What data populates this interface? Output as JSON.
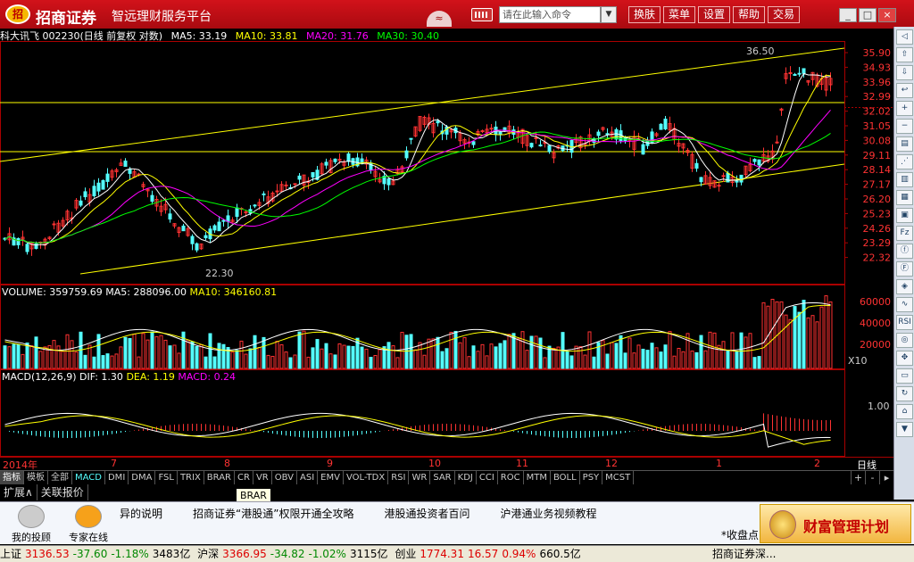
{
  "titlebar": {
    "logo_char": "招",
    "app_name": "招商证券",
    "subtitle": "智远理财服务平台",
    "fold_icon": "≈",
    "cmd_placeholder": "请在此输入命令",
    "cmd_drop": "▼",
    "menu": [
      "换肤",
      "菜单",
      "设置",
      "帮助",
      "交易"
    ],
    "win_buttons": [
      "_",
      "□",
      "×"
    ]
  },
  "header": {
    "stock": "科大讯飞 002230(日线 前复权 对数)",
    "ma5": "MA5: 33.19",
    "ma10": "MA10: 33.81",
    "ma20": "MA20: 31.76",
    "ma30": "MA30: 30.40"
  },
  "price_chart": {
    "y_labels": [
      "35.90",
      "34.93",
      "33.96",
      "32.99",
      "32.02",
      "31.05",
      "30.08",
      "29.11",
      "28.14",
      "27.17",
      "26.20",
      "25.23",
      "24.26",
      "23.29",
      "22.32"
    ],
    "high_label": "36.50",
    "low_label": "22.30"
  },
  "volume_chart": {
    "label": "VOLUME: 359759.69",
    "ma5": "MA5: 288096.00",
    "ma10": "MA10: 346160.81",
    "y_labels": [
      "60000",
      "40000",
      "20000"
    ],
    "unit": "X10"
  },
  "macd_chart": {
    "label": "MACD(12,26,9)",
    "dif": "DIF: 1.30",
    "dea": "DEA: 1.19",
    "macd": "MACD: 0.24",
    "y_label": "1.00"
  },
  "x_axis": {
    "labels": [
      "2014年",
      "7",
      "8",
      "9",
      "10",
      "11",
      "12",
      "1",
      "2"
    ],
    "period": "日线"
  },
  "indicator_tabs": [
    "指标",
    "模板",
    "全部",
    "MACD",
    "DMI",
    "DMA",
    "FSL",
    "TRIX",
    "BRAR",
    "CR",
    "VR",
    "OBV",
    "ASI",
    "EMV",
    "VOL-TDX",
    "RSI",
    "WR",
    "SAR",
    "KDJ",
    "CCI",
    "ROC",
    "MTM",
    "BOLL",
    "PSY",
    "MCST"
  ],
  "tab_nav": [
    "+",
    "-",
    "▸"
  ],
  "expand_row": [
    "扩展∧",
    "关联报价"
  ],
  "tooltip": "BRAR",
  "right_toolbar": [
    "◁",
    "⇧",
    "⇩",
    "↩",
    "+",
    "−",
    "▤",
    "⋰",
    "▥",
    "▦",
    "▣",
    "Fz",
    "ⓕ",
    "Ⓕ",
    "◈",
    "∿",
    "RSI",
    "◎",
    "✥",
    "▭",
    "↻",
    "⌂",
    "▼"
  ],
  "info_bar": {
    "buttons": [
      "我的投顾",
      "专家在线"
    ],
    "news": [
      "异的说明",
      "招商证券“港股通”权限开通全攻略",
      "港股通投资者百问",
      "沪港通业务视频教程"
    ],
    "collapse": "*收盘点",
    "ad": "财富管理计划"
  },
  "ticker": {
    "sh_name": "上证",
    "sh_price": "3136.53",
    "sh_chg": "-37.60",
    "sh_pct": "-1.18%",
    "sh_amt": "3483亿",
    "hs_name": "沪深",
    "hs_price": "3366.95",
    "hs_chg": "-34.82",
    "hs_pct": "-1.02%",
    "hs_amt": "3115亿",
    "cy_name": "创业",
    "cy_price": "1774.31",
    "cy_chg": "16.57",
    "cy_pct": "0.94%",
    "cy_amt": "660.5亿",
    "tail": "招商证券深..."
  },
  "colors": {
    "up": "#ff3232",
    "down": "#54ffff",
    "ma5": "#ffffff",
    "ma10": "#ffff00",
    "ma20": "#ff00ff",
    "ma30": "#00ff00",
    "channel": "#ffff00"
  }
}
